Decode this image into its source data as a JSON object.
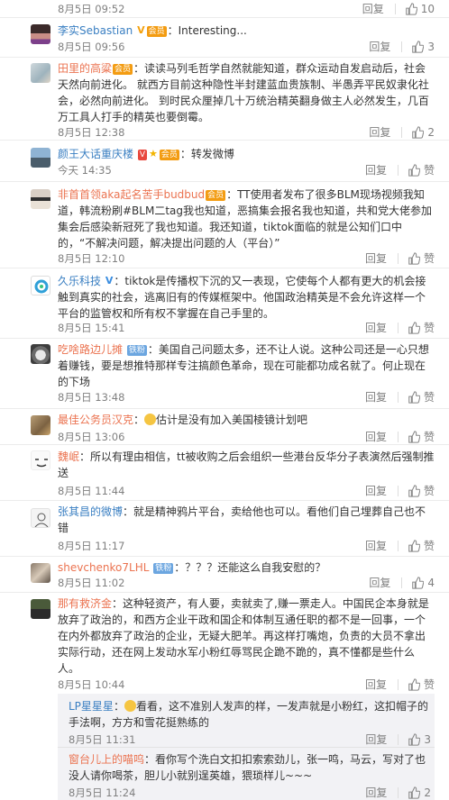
{
  "comments": [
    {
      "time": "8月5日 09:52",
      "reply": "回复",
      "likes": "10"
    },
    {
      "user": "李实Sebastian",
      "text": "Interesting...",
      "time": "8月5日 09:56",
      "reply": "回复",
      "likes": "3"
    },
    {
      "user": "田里的高粱",
      "text": "读读马列毛哲学自然就能知道，群众运动自发启动后，社会天然向前进化。 就西方目前这种隐性半封建蓝血贵族制、半愚弄平民奴隶化社会，必然向前进化。 到时民众厘掉几十万统治精英翻身做主人必然发生，几百万工具人打手的精英也要倒霉。",
      "time": "8月5日 12:38",
      "reply": "回复",
      "likes": "2"
    },
    {
      "user": "颜王大话重庆楼",
      "text": "转发微博",
      "time": "今天 14:35",
      "reply": "回复",
      "likes": "赞"
    },
    {
      "user": "非首首领aka起名苦手budbud",
      "text": "TT使用者发布了很多BLM现场视频我知道，韩流粉刷#BLM二tag我也知道，恶搞集会报名我也知道，共和党大佬参加集会后感染新冠死了我也知道。我还知道，tiktok面临的就是公知们口中的，“不解决问题，解决提出问题的人（平台）”",
      "time": "8月5日 12:10",
      "reply": "回复",
      "likes": "赞"
    },
    {
      "user": "久乐科技",
      "text": "tiktok是传播权下沉的又一表现，它使每个人都有更大的机会接触到真实的社会，逃离旧有的传媒框架中。他国政治精英是不会允许这样一个平台的监管权和所有权不掌握在自己手里的。",
      "time": "8月5日 15:41",
      "reply": "回复",
      "likes": "赞"
    },
    {
      "user": "吃啥路边儿摊",
      "text": "美国自己问题太多，还不让人说。这种公司还是一心只想着赚钱，要是想推特那样专注搞颜色革命，现在可能都功成名就了。何止现在的下场",
      "time": "8月5日 13:48",
      "reply": "回复",
      "likes": "赞"
    },
    {
      "user": "最佳公务员汉克",
      "text": "估计是没有加入美国棱镜计划吧",
      "time": "8月5日 13:06",
      "reply": "回复",
      "likes": "赞"
    },
    {
      "user": "魏岷",
      "text": "所以有理由相信，tt被收购之后会组织一些港台反华分子表演然后强制推送",
      "time": "8月5日 11:44",
      "reply": "回复",
      "likes": "赞"
    },
    {
      "user": "张其昌的微博",
      "text": "就是精神鸦片平台，卖给他也可以。看他们自己埋葬自己也不错",
      "time": "8月5日 11:17",
      "reply": "回复",
      "likes": "赞"
    },
    {
      "user": "shevchenko7LHL",
      "text": "？？？还能这么自我安慰的？",
      "time": "8月5日 11:02",
      "reply": "回复",
      "likes": "4"
    },
    {
      "user": "那有救济金",
      "text": "这种轻资产，有人要，卖就卖了,赚一票走人。中国民企本身就是放弃了政治的，和西方企业干政和国企和体制互通任职的都不是一回事，一个在内外都放弃了政治的企业，无疑大肥羊。再这样打嘴炮，负责的大员不拿出实际行动，还在网上发动水军小粉红辱骂民企跪不跪的，真不懂都是些什么人。",
      "time": "8月5日 10:44",
      "reply": "回复",
      "likes": "赞"
    }
  ],
  "subreplies": [
    {
      "user": "LP星星星",
      "text": "看看，这不准别人发声的样，一发声就是小粉红，这扣帽子的手法啊，方方和雪花挺熟练的",
      "time": "8月5日 11:31",
      "reply": "回复",
      "likes": "3"
    },
    {
      "user": "窗台儿上的喵呜",
      "text": "看你写个洗白文扣扣索索劲儿，张一鸣，马云，写对了也没人请你喝茶，胆儿小就别逞英雄，猥琐样儿~~~",
      "time": "8月5日 11:24",
      "reply": "回复",
      "likes": "2"
    }
  ],
  "badges": {
    "vip": "会员",
    "member": "铁粉"
  },
  "colors": {
    "username": "#eb7350",
    "link": "#3a7fc2",
    "meta": "#808080",
    "subbg": "#f2f2f5"
  }
}
